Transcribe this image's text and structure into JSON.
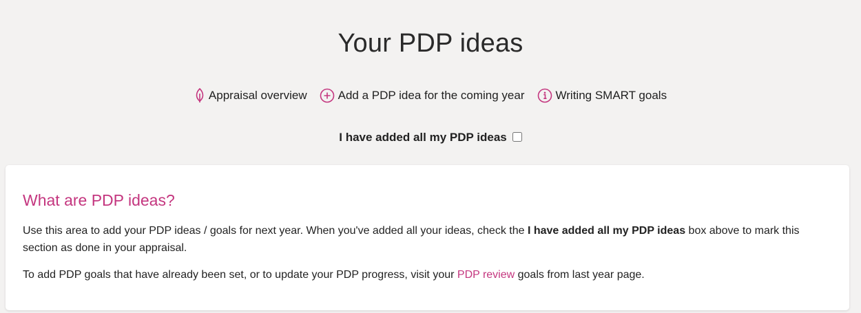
{
  "page": {
    "title": "Your PDP ideas"
  },
  "actions": {
    "appraisal_overview": "Appraisal overview",
    "add_pdp_idea": "Add a PDP idea for the coming year",
    "writing_smart_goals": "Writing SMART goals"
  },
  "done_checkbox": {
    "label": "I have added all my PDP ideas",
    "checked": false
  },
  "info_card": {
    "heading": "What are PDP ideas?",
    "para1_before": "Use this area to add your PDP ideas / goals for next year. When you've added all your ideas, check the ",
    "para1_bold": "I have added all my PDP ideas",
    "para1_after": " box above to mark this section as done in your appraisal.",
    "para2_before": "To add PDP goals that have already been set, or to update your PDP progress, visit your ",
    "para2_link": "PDP review",
    "para2_after": " goals from last year page."
  },
  "colors": {
    "accent": "#c4367f",
    "background": "#f3f2f1",
    "card": "#ffffff"
  },
  "icons": {
    "appraisal_overview": "leaf-icon",
    "add_pdp_idea": "plus-circle-icon",
    "writing_smart_goals": "info-circle-icon"
  }
}
